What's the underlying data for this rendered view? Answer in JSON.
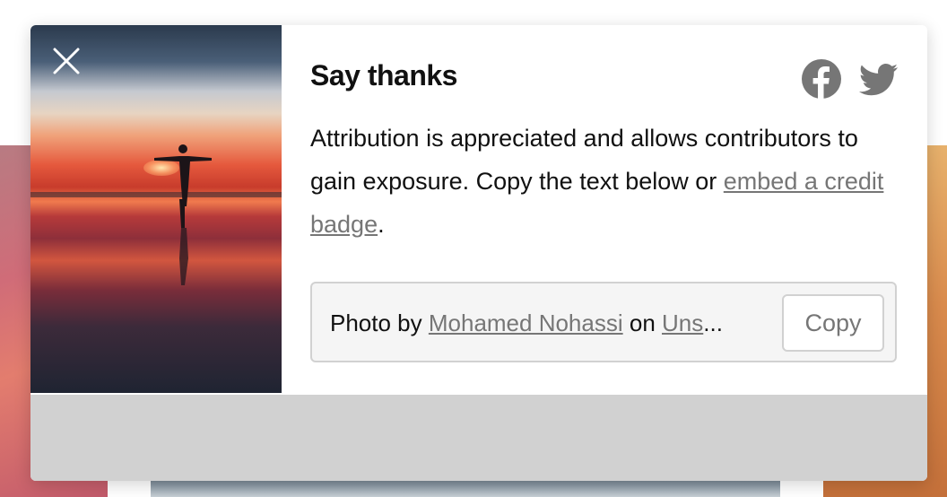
{
  "modal": {
    "title": "Say thanks",
    "description_text": "Attribution is appreciated and allows contributors to gain exposure. Copy the text below or ",
    "embed_link": "embed a credit badge",
    "description_end": ".",
    "social": {
      "facebook_icon": "facebook-icon",
      "twitter_icon": "twitter-icon"
    },
    "close_icon": "close-icon",
    "credit": {
      "prefix": "Photo by ",
      "photographer": "Mohamed Nohassi",
      "middle": " on ",
      "platform_truncated": "Uns",
      "ellipsis": "..."
    },
    "copy_label": "Copy"
  },
  "colors": {
    "text": "#111111",
    "muted": "#767676",
    "border": "#d1d1d1",
    "box_bg": "#f5f5f5"
  }
}
